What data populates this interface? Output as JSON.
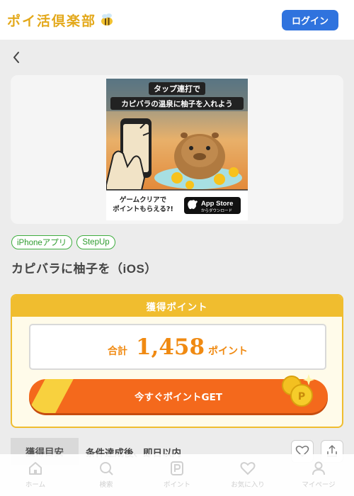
{
  "header": {
    "logo_text": "ポイ活倶楽部",
    "login_label": "ログイン"
  },
  "banner": {
    "line1": "タップ連打で",
    "line2": "カピバラの温泉に柚子を入れよう",
    "footer_line1": "ゲームクリアで",
    "footer_line2": "ポイントもらえる?!",
    "store_small": "",
    "store_big": "App Store",
    "store_sub": "からダウンロード"
  },
  "tags": [
    "iPhoneアプリ",
    "StepUp"
  ],
  "offer": {
    "title": "カピバラに柚子を（iOS）"
  },
  "points": {
    "header": "獲得ポイント",
    "total_label": "合計",
    "total_value": "1,458",
    "total_unit": "ポイント",
    "cta_label": "今すぐポイントGET"
  },
  "info": {
    "label": "獲得目安",
    "value": "条件達成後、即日以内"
  },
  "tabbar": {
    "items": [
      {
        "label": "ホーム",
        "icon": "home-icon"
      },
      {
        "label": "検索",
        "icon": "search-icon"
      },
      {
        "label": "ポイント",
        "icon": "points-icon"
      },
      {
        "label": "お気に入り",
        "icon": "heart-icon"
      },
      {
        "label": "マイページ",
        "icon": "user-icon"
      }
    ]
  },
  "colors": {
    "accent_orange": "#f4691c",
    "gold": "#f0bd2f",
    "login_blue": "#2f73de",
    "tag_green": "#3fae3f"
  }
}
